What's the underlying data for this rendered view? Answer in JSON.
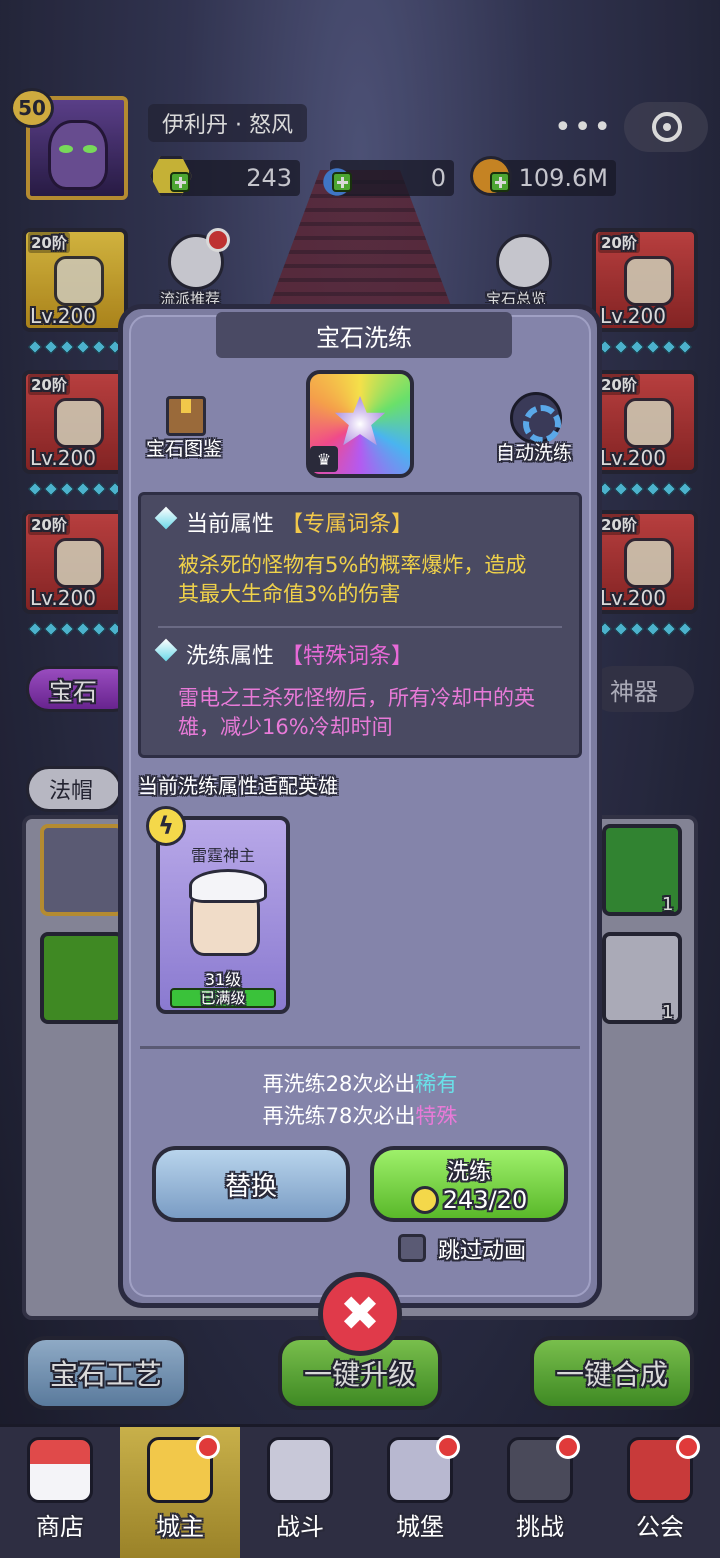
{
  "header": {
    "player_level": "50",
    "player_name": "伊利丹 · 怒风",
    "menu_dots": "•••",
    "resources": {
      "gems": "243",
      "potions": "0",
      "gold": "109.6M"
    }
  },
  "side": {
    "left_button_label": "流派推荐",
    "right_button_label": "宝石总览"
  },
  "slots": {
    "tier": "20阶",
    "level": "Lv.200"
  },
  "behind": {
    "tab_gem": "宝石",
    "tab_artifact": "神器",
    "filter_hat": "法帽",
    "count_1": "1",
    "count_2": "1",
    "btn_craft": "宝石工艺",
    "btn_upgrade": "一键升级",
    "btn_merge": "一键合成"
  },
  "modal": {
    "title": "宝石洗练",
    "gem_codex_label": "宝石图鉴",
    "auto_wash_label": "自动洗练",
    "current_attr_label": "当前属性",
    "current_attr_tag": "【专属词条】",
    "current_attr_text_1": "被杀死的怪物有5%的概率爆炸，造成",
    "current_attr_text_2": "其最大生命值3%的伤害",
    "wash_attr_label": "洗练属性",
    "wash_attr_tag": "【特殊词条】",
    "wash_attr_text_1": "雷电之王杀死怪物后，所有冷却中的英",
    "wash_attr_text_2": "雄，减少16%冷却时间",
    "hero_section_label": "当前洗练属性适配英雄",
    "hero": {
      "name": "雷霆神主",
      "level": "31级",
      "status": "已满级"
    },
    "guarantee_1_prefix": "再洗练28次必出",
    "guarantee_1_rarity": "稀有",
    "guarantee_2_prefix": "再洗练78次必出",
    "guarantee_2_rarity": "特殊",
    "replace_button": "替换",
    "wash_button": "洗练",
    "wash_cost": "243/20",
    "skip_animation": "跳过动画",
    "crown_glyph": "♛",
    "bolt_glyph": "ϟ",
    "close_glyph": "✖"
  },
  "nav": [
    {
      "label": "商店"
    },
    {
      "label": "城主"
    },
    {
      "label": "战斗"
    },
    {
      "label": "城堡"
    },
    {
      "label": "挑战"
    },
    {
      "label": "公会"
    }
  ],
  "colors": {
    "accent_gold": "#f2c84a",
    "special_pink": "#e87ad8",
    "rare_cyan": "#6ae0e8",
    "button_green": "#5ab82a",
    "close_red": "#e03a4a"
  }
}
